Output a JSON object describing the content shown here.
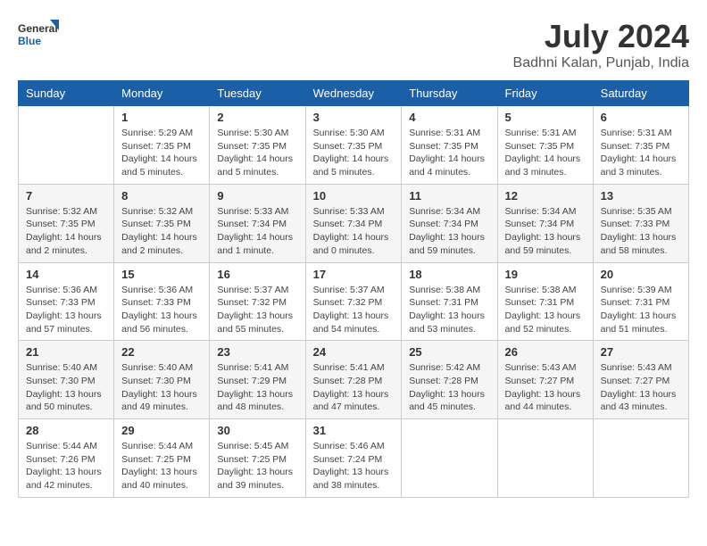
{
  "logo": {
    "line1": "General",
    "line2": "Blue"
  },
  "title": "July 2024",
  "subtitle": "Badhni Kalan, Punjab, India",
  "days_of_week": [
    "Sunday",
    "Monday",
    "Tuesday",
    "Wednesday",
    "Thursday",
    "Friday",
    "Saturday"
  ],
  "weeks": [
    [
      {
        "day": "",
        "info": ""
      },
      {
        "day": "1",
        "info": "Sunrise: 5:29 AM\nSunset: 7:35 PM\nDaylight: 14 hours\nand 5 minutes."
      },
      {
        "day": "2",
        "info": "Sunrise: 5:30 AM\nSunset: 7:35 PM\nDaylight: 14 hours\nand 5 minutes."
      },
      {
        "day": "3",
        "info": "Sunrise: 5:30 AM\nSunset: 7:35 PM\nDaylight: 14 hours\nand 5 minutes."
      },
      {
        "day": "4",
        "info": "Sunrise: 5:31 AM\nSunset: 7:35 PM\nDaylight: 14 hours\nand 4 minutes."
      },
      {
        "day": "5",
        "info": "Sunrise: 5:31 AM\nSunset: 7:35 PM\nDaylight: 14 hours\nand 3 minutes."
      },
      {
        "day": "6",
        "info": "Sunrise: 5:31 AM\nSunset: 7:35 PM\nDaylight: 14 hours\nand 3 minutes."
      }
    ],
    [
      {
        "day": "7",
        "info": "Sunrise: 5:32 AM\nSunset: 7:35 PM\nDaylight: 14 hours\nand 2 minutes."
      },
      {
        "day": "8",
        "info": "Sunrise: 5:32 AM\nSunset: 7:35 PM\nDaylight: 14 hours\nand 2 minutes."
      },
      {
        "day": "9",
        "info": "Sunrise: 5:33 AM\nSunset: 7:34 PM\nDaylight: 14 hours\nand 1 minute."
      },
      {
        "day": "10",
        "info": "Sunrise: 5:33 AM\nSunset: 7:34 PM\nDaylight: 14 hours\nand 0 minutes."
      },
      {
        "day": "11",
        "info": "Sunrise: 5:34 AM\nSunset: 7:34 PM\nDaylight: 13 hours\nand 59 minutes."
      },
      {
        "day": "12",
        "info": "Sunrise: 5:34 AM\nSunset: 7:34 PM\nDaylight: 13 hours\nand 59 minutes."
      },
      {
        "day": "13",
        "info": "Sunrise: 5:35 AM\nSunset: 7:33 PM\nDaylight: 13 hours\nand 58 minutes."
      }
    ],
    [
      {
        "day": "14",
        "info": "Sunrise: 5:36 AM\nSunset: 7:33 PM\nDaylight: 13 hours\nand 57 minutes."
      },
      {
        "day": "15",
        "info": "Sunrise: 5:36 AM\nSunset: 7:33 PM\nDaylight: 13 hours\nand 56 minutes."
      },
      {
        "day": "16",
        "info": "Sunrise: 5:37 AM\nSunset: 7:32 PM\nDaylight: 13 hours\nand 55 minutes."
      },
      {
        "day": "17",
        "info": "Sunrise: 5:37 AM\nSunset: 7:32 PM\nDaylight: 13 hours\nand 54 minutes."
      },
      {
        "day": "18",
        "info": "Sunrise: 5:38 AM\nSunset: 7:31 PM\nDaylight: 13 hours\nand 53 minutes."
      },
      {
        "day": "19",
        "info": "Sunrise: 5:38 AM\nSunset: 7:31 PM\nDaylight: 13 hours\nand 52 minutes."
      },
      {
        "day": "20",
        "info": "Sunrise: 5:39 AM\nSunset: 7:31 PM\nDaylight: 13 hours\nand 51 minutes."
      }
    ],
    [
      {
        "day": "21",
        "info": "Sunrise: 5:40 AM\nSunset: 7:30 PM\nDaylight: 13 hours\nand 50 minutes."
      },
      {
        "day": "22",
        "info": "Sunrise: 5:40 AM\nSunset: 7:30 PM\nDaylight: 13 hours\nand 49 minutes."
      },
      {
        "day": "23",
        "info": "Sunrise: 5:41 AM\nSunset: 7:29 PM\nDaylight: 13 hours\nand 48 minutes."
      },
      {
        "day": "24",
        "info": "Sunrise: 5:41 AM\nSunset: 7:28 PM\nDaylight: 13 hours\nand 47 minutes."
      },
      {
        "day": "25",
        "info": "Sunrise: 5:42 AM\nSunset: 7:28 PM\nDaylight: 13 hours\nand 45 minutes."
      },
      {
        "day": "26",
        "info": "Sunrise: 5:43 AM\nSunset: 7:27 PM\nDaylight: 13 hours\nand 44 minutes."
      },
      {
        "day": "27",
        "info": "Sunrise: 5:43 AM\nSunset: 7:27 PM\nDaylight: 13 hours\nand 43 minutes."
      }
    ],
    [
      {
        "day": "28",
        "info": "Sunrise: 5:44 AM\nSunset: 7:26 PM\nDaylight: 13 hours\nand 42 minutes."
      },
      {
        "day": "29",
        "info": "Sunrise: 5:44 AM\nSunset: 7:25 PM\nDaylight: 13 hours\nand 40 minutes."
      },
      {
        "day": "30",
        "info": "Sunrise: 5:45 AM\nSunset: 7:25 PM\nDaylight: 13 hours\nand 39 minutes."
      },
      {
        "day": "31",
        "info": "Sunrise: 5:46 AM\nSunset: 7:24 PM\nDaylight: 13 hours\nand 38 minutes."
      },
      {
        "day": "",
        "info": ""
      },
      {
        "day": "",
        "info": ""
      },
      {
        "day": "",
        "info": ""
      }
    ]
  ]
}
